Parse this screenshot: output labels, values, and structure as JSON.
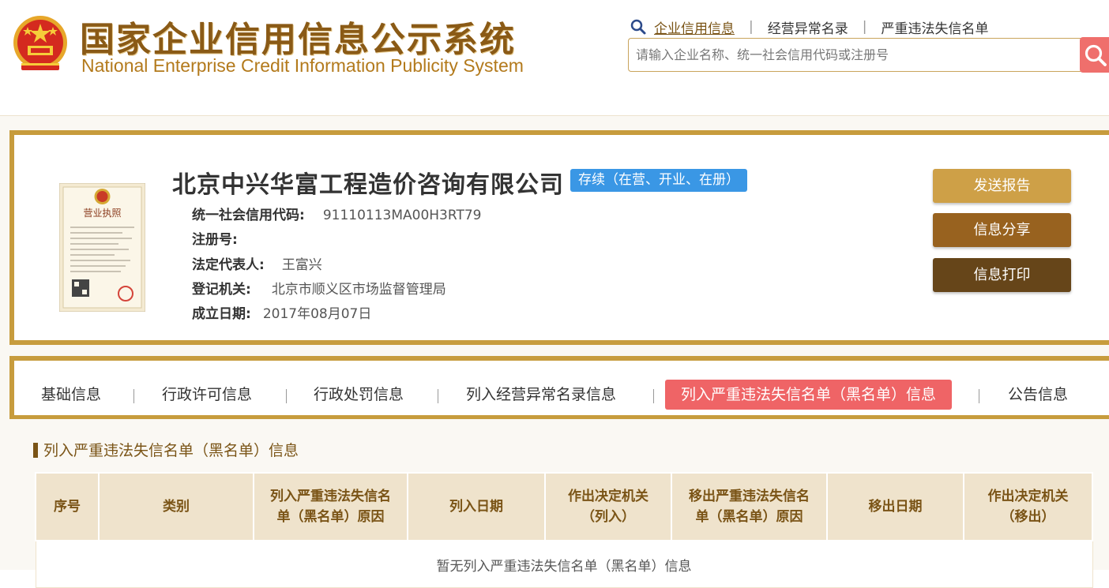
{
  "header": {
    "title_cn": "国家企业信用信息公示系统",
    "title_en": "National Enterprise Credit Information Publicity System",
    "links": [
      {
        "label": "企业信用信息",
        "active": true
      },
      {
        "label": "经营异常名录",
        "active": false
      },
      {
        "label": "严重违法失信名单",
        "active": false
      }
    ],
    "search": {
      "placeholder": "请输入企业名称、统一社会信用代码或注册号",
      "value": ""
    }
  },
  "company": {
    "name": "北京中兴华富工程造价咨询有限公司",
    "status": "存续（在营、开业、在册）",
    "license_image_label": "营业执照",
    "fields": [
      {
        "label": "统一社会信用代码:",
        "value": "91110113MA00H3RT79"
      },
      {
        "label": "注册号:",
        "value": ""
      },
      {
        "label": "法定代表人:",
        "value": "王富兴"
      },
      {
        "label": "登记机关:",
        "value": "北京市顺义区市场监督管理局"
      },
      {
        "label": "成立日期:",
        "value": "2017年08月07日"
      }
    ],
    "actions": {
      "send": "发送报告",
      "share": "信息分享",
      "print": "信息打印"
    }
  },
  "tabs": [
    {
      "label": "基础信息",
      "active": false
    },
    {
      "label": "行政许可信息",
      "active": false
    },
    {
      "label": "行政处罚信息",
      "active": false
    },
    {
      "label": "列入经营异常名录信息",
      "active": false
    },
    {
      "label": "列入严重违法失信名单（黑名单）信息",
      "active": true
    },
    {
      "label": "公告信息",
      "active": false
    }
  ],
  "section": {
    "title": "列入严重违法失信名单（黑名单）信息",
    "columns": [
      {
        "line1": "序号",
        "line2": ""
      },
      {
        "line1": "类别",
        "line2": ""
      },
      {
        "line1": "列入严重违法失信名",
        "line2": "单（黑名单）原因"
      },
      {
        "line1": "列入日期",
        "line2": ""
      },
      {
        "line1": "作出决定机关",
        "line2": "（列入）"
      },
      {
        "line1": "移出严重违法失信名",
        "line2": "单（黑名单）原因"
      },
      {
        "line1": "移出日期",
        "line2": ""
      },
      {
        "line1": "作出决定机关",
        "line2": "（移出）"
      }
    ],
    "empty_message": "暂无列入严重违法失信名单（黑名单）信息"
  },
  "colors": {
    "gold_border": "#c79c3d",
    "brown_text": "#7a5416",
    "status_blue": "#3a97e5",
    "active_tab_red": "#ef6466",
    "search_red": "#ef6f6c"
  }
}
